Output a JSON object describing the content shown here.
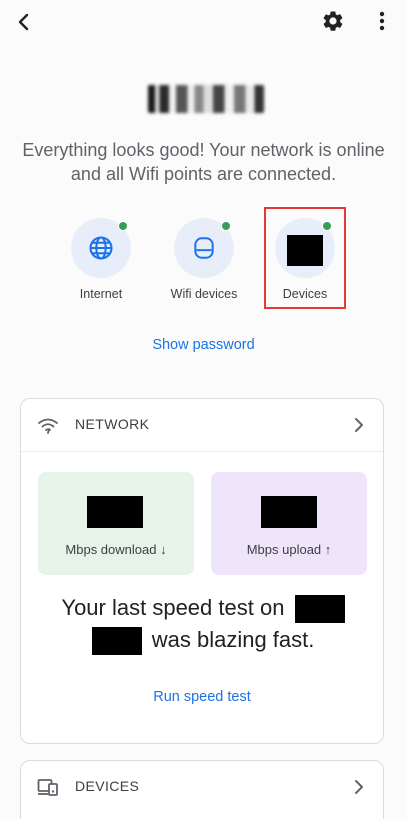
{
  "header": {
    "back_icon": "chevron-left-icon",
    "settings_icon": "gear-icon",
    "more_icon": "more-vertical-icon"
  },
  "network": {
    "status_message": "Everything looks good! Your network is online and all Wifi points are connected."
  },
  "status_items": [
    {
      "label": "Internet",
      "icon": "globe-icon",
      "status_color": "#3a9c57"
    },
    {
      "label": "Wifi devices",
      "icon": "router-icon",
      "status_color": "#3a9c57"
    },
    {
      "label": "Devices",
      "icon": "devices-icon",
      "status_color": "#3a9c57"
    }
  ],
  "actions": {
    "show_password": "Show password",
    "run_speed_test": "Run speed test"
  },
  "network_card": {
    "title": "NETWORK",
    "download_label": "Mbps download ↓",
    "upload_label": "Mbps upload ↑",
    "summary_prefix": "Your last speed test on",
    "summary_suffix": "was blazing fast."
  },
  "devices_card": {
    "title": "DEVICES"
  },
  "colors": {
    "accent": "#1a73e8",
    "ok": "#3a9c57",
    "highlight": "#e53935",
    "download_bg": "#e6f3e9",
    "upload_bg": "#efe5fb"
  }
}
